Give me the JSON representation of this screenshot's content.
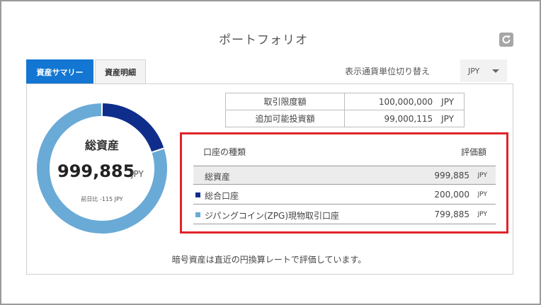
{
  "header": {
    "title": "ポートフォリオ",
    "refresh_icon": "refresh-icon"
  },
  "tabs": [
    {
      "label": "資産サマリー",
      "active": true
    },
    {
      "label": "資産明細",
      "active": false
    }
  ],
  "currency": {
    "label": "表示通貨単位切り替え",
    "selected": "JPY"
  },
  "summary": {
    "title": "総資産",
    "value": "999,885",
    "unit": "JPY",
    "change": "前日比 -115 JPY",
    "segments": [
      {
        "name": "総合口座",
        "value": 200000,
        "color": "#0f2d8a"
      },
      {
        "name": "ジパングコイン(ZPG)現物取引口座",
        "value": 799885,
        "color": "#6aaad6"
      }
    ]
  },
  "limits": [
    {
      "label": "取引限度額",
      "value": "100,000,000　JPY"
    },
    {
      "label": "追加可能投資額",
      "value": "99,000,115　JPY"
    }
  ],
  "accounts": {
    "header_type": "口座の種類",
    "header_value": "評価額",
    "rows": [
      {
        "name": "総資産",
        "amount": "999,885",
        "unit": "JPY"
      },
      {
        "name": "総合口座",
        "amount": "200,000",
        "unit": "JPY",
        "color": "#0f2d8a"
      },
      {
        "name": "ジパングコイン(ZPG)現物取引口座",
        "amount": "799,885",
        "unit": "JPY",
        "color": "#6aaad6"
      }
    ]
  },
  "footnote": "暗号資産は直近の円換算レートで評価しています。"
}
